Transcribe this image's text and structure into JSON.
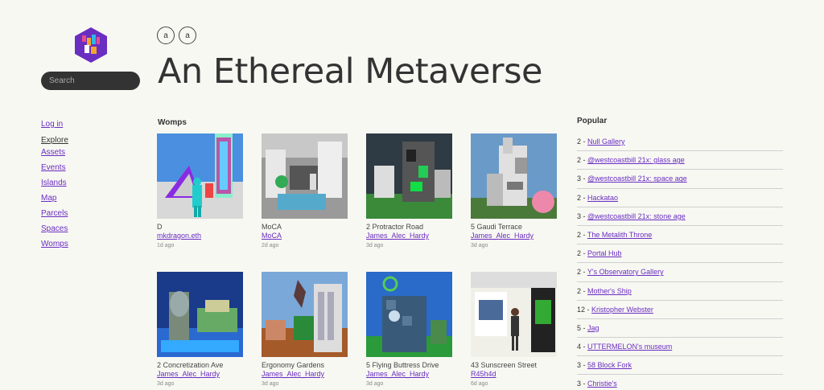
{
  "search": {
    "placeholder": "Search"
  },
  "header": {
    "title": "An Ethereal Metaverse",
    "circle_buttons": [
      "a",
      "a"
    ]
  },
  "nav": {
    "login": "Log in",
    "explore": "Explore",
    "items": [
      "Assets",
      "Events",
      "Islands",
      "Map",
      "Parcels",
      "Spaces",
      "Womps"
    ]
  },
  "womps": {
    "heading": "Womps",
    "cards": [
      {
        "title": "D",
        "author": "mkdragon.eth",
        "time": "1d ago"
      },
      {
        "title": "MoCA",
        "author": "MoCA",
        "time": "2d ago"
      },
      {
        "title": "2 Protractor Road",
        "author": "James_Alec_Hardy",
        "time": "3d ago"
      },
      {
        "title": "5 Gaudi Terrace",
        "author": "James_Alec_Hardy",
        "time": "3d ago"
      },
      {
        "title": "2 Concretization Ave",
        "author": "James_Alec_Hardy",
        "time": "3d ago"
      },
      {
        "title": "Ergonomy Gardens",
        "author": "James_Alec_Hardy",
        "time": "3d ago"
      },
      {
        "title": "5 Flying Buttress Drive",
        "author": "James_Alec_Hardy",
        "time": "3d ago"
      },
      {
        "title": "43 Sunscreen Street",
        "author": "R45h4d",
        "time": "6d ago"
      }
    ]
  },
  "popular": {
    "heading": "Popular",
    "items": [
      {
        "count": "2",
        "name": "Null Gallery"
      },
      {
        "count": "2",
        "name": "@westcoastbill 21x: glass age"
      },
      {
        "count": "3",
        "name": "@westcoastbill 21x: space age"
      },
      {
        "count": "2",
        "name": "Hackatao"
      },
      {
        "count": "3",
        "name": "@westcoastbill 21x: stone age"
      },
      {
        "count": "2",
        "name": "The Metalith Throne"
      },
      {
        "count": "2",
        "name": "Portal Hub"
      },
      {
        "count": "2",
        "name": "Y's Observatory Gallery"
      },
      {
        "count": "2",
        "name": "Mother's Ship"
      },
      {
        "count": "12",
        "name": "Kristopher Webster"
      },
      {
        "count": "5",
        "name": "Jag"
      },
      {
        "count": "4",
        "name": "UTTERMELON's museum"
      },
      {
        "count": "3",
        "name": "58 Block Fork"
      },
      {
        "count": "3",
        "name": "Christie's"
      }
    ]
  },
  "colors": {
    "accent": "#6a2ec1",
    "background": "#f8f8f3",
    "search_bg": "#333333"
  }
}
